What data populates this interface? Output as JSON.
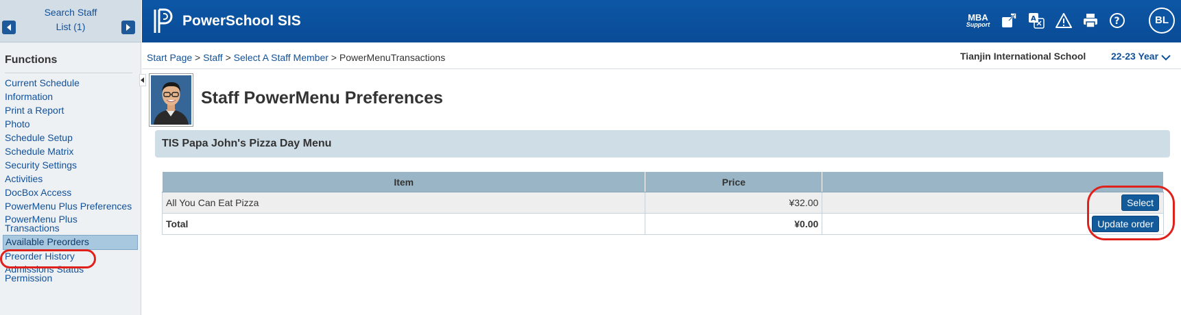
{
  "staff_nav": {
    "line1": "Search Staff",
    "line2": "List (1)"
  },
  "header": {
    "app_title": "PowerSchool SIS",
    "mba_top": "MBA",
    "mba_bottom": "Support",
    "user_initials": "BL"
  },
  "functions": {
    "heading": "Functions",
    "items": [
      {
        "label": "Current Schedule"
      },
      {
        "label": "Information"
      },
      {
        "label": "Print a Report"
      },
      {
        "label": "Photo"
      },
      {
        "label": "Schedule Setup"
      },
      {
        "label": "Schedule Matrix"
      },
      {
        "label": "Security Settings"
      },
      {
        "label": "Activities"
      },
      {
        "label": "DocBox Access"
      },
      {
        "label": "PowerMenu Plus Preferences"
      },
      {
        "label": "PowerMenu Plus Transactions"
      },
      {
        "label": "Available Preorders",
        "selected": true
      },
      {
        "label": "Preorder History"
      },
      {
        "label": "Admissions Status Permission"
      }
    ]
  },
  "breadcrumb": {
    "start_page": "Start Page",
    "staff": "Staff",
    "select_staff": "Select A Staff Member",
    "current": "PowerMenuTransactions",
    "sep": ">"
  },
  "school_name": "Tianjin International School",
  "term": "22-23 Year",
  "page_title": "Staff PowerMenu Preferences",
  "menu_title": "TIS Papa John's Pizza Day Menu",
  "table": {
    "col_item": "Item",
    "col_price": "Price",
    "row_item": "All You Can Eat Pizza",
    "row_price": "¥32.00",
    "select_label": "Select",
    "total_label": "Total",
    "total_value": "¥0.00",
    "update_label": "Update order"
  },
  "colors": {
    "header_blue": "#0c57a6",
    "link_blue": "#10509a",
    "annotation_red": "#e0201b",
    "table_header": "#9ab6c6"
  }
}
